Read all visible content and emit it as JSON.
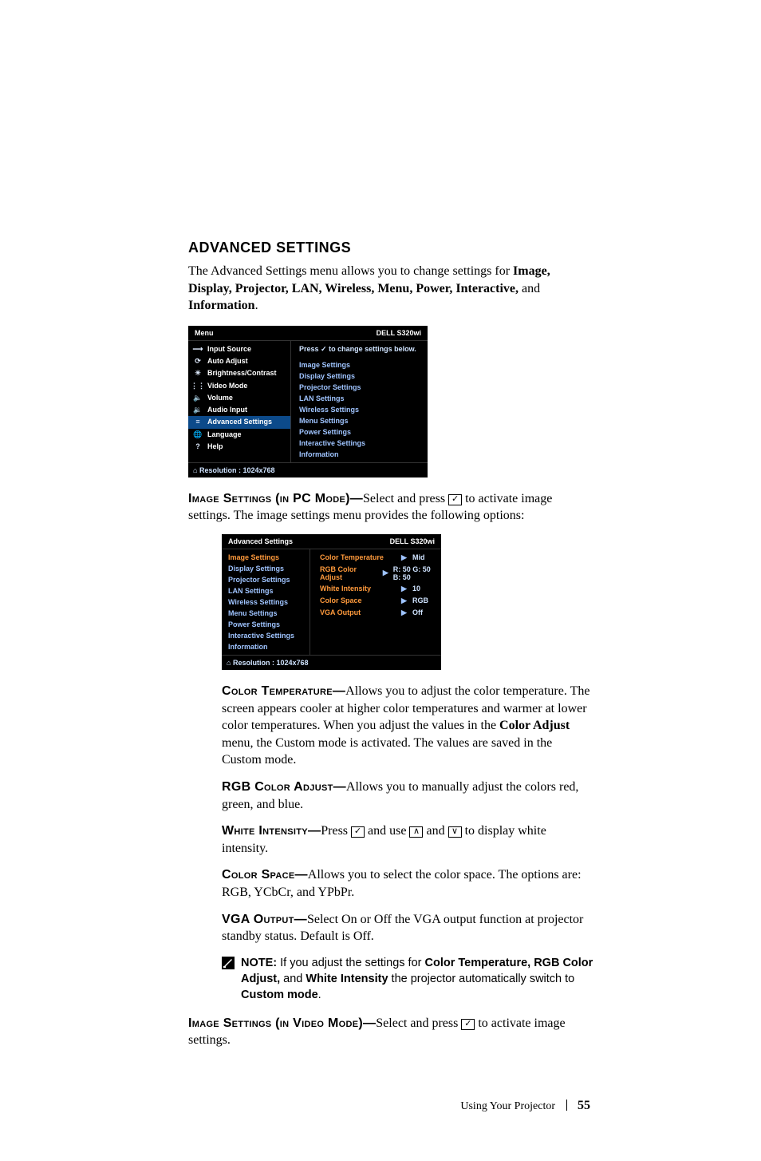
{
  "section": {
    "title": "ADVANCED SETTINGS",
    "intro_a": "The Advanced Settings menu allows you to change settings for ",
    "intro_b": "Image, Display, Projector, LAN, Wireless, Menu, Power, Interactive,",
    "intro_c": " and ",
    "intro_d": "Information",
    "intro_e": "."
  },
  "osd1": {
    "title_left": "Menu",
    "title_right": "DELL S320wi",
    "press_prefix": "Press ",
    "press_glyph": "✓",
    "press_suffix": " to change settings below.",
    "left_items": [
      {
        "icon": "⟶",
        "label": "Input Source"
      },
      {
        "icon": "⟳",
        "label": "Auto Adjust"
      },
      {
        "icon": "☀",
        "label": "Brightness/Contrast"
      },
      {
        "icon": "⋮⋮",
        "label": "Video Mode"
      },
      {
        "icon": "🔈",
        "label": "Volume"
      },
      {
        "icon": "🔉",
        "label": "Audio Input"
      },
      {
        "icon": "≡",
        "label": "Advanced Settings",
        "selected": true
      },
      {
        "icon": "🌐",
        "label": "Language"
      },
      {
        "icon": "?",
        "label": "Help"
      }
    ],
    "right_items": [
      "Image Settings",
      "Display Settings",
      "Projector Settings",
      "LAN Settings",
      "Wireless Settings",
      "Menu Settings",
      "Power Settings",
      "Interactive Settings",
      "Information"
    ],
    "footer": "Resolution : 1024x768"
  },
  "para_pc": {
    "runin": "Image Settings (in PC Mode)—",
    "a": "Select and press ",
    "b": " to activate image settings. The image settings menu provides the following options:"
  },
  "osd2": {
    "title_left": "Advanced Settings",
    "title_right": "DELL S320wi",
    "left_items": [
      {
        "label": "Image Settings",
        "selected": true
      },
      {
        "label": "Display Settings"
      },
      {
        "label": "Projector Settings"
      },
      {
        "label": "LAN Settings"
      },
      {
        "label": "Wireless Settings"
      },
      {
        "label": "Menu Settings"
      },
      {
        "label": "Power Settings"
      },
      {
        "label": "Interactive Settings"
      },
      {
        "label": "Information"
      }
    ],
    "kv": [
      {
        "k": "Color Temperature",
        "v": "Mid"
      },
      {
        "k": "RGB Color Adjust",
        "v": "R: 50 G: 50 B: 50"
      },
      {
        "k": "White Intensity",
        "v": "10"
      },
      {
        "k": "Color Space",
        "v": "RGB"
      },
      {
        "k": "VGA Output",
        "v": "Off"
      }
    ],
    "footer": "Resolution : 1024x768"
  },
  "desc": {
    "color_temp": {
      "runin": "Color Temperature—",
      "text": "Allows you to adjust the color temperature. The screen appears cooler at higher color temperatures and warmer at lower color temperatures. When you adjust the values in the ",
      "bold": "Color Adjust",
      "text2": " menu, the Custom mode is activated. The values are saved in the Custom mode."
    },
    "rgb": {
      "runin": "RGB Color Adjust—",
      "text": "Allows you to manually adjust the colors red, green, and blue."
    },
    "white": {
      "runin": "White Intensity—",
      "a": "Press ",
      "b": " and use ",
      "c": " and ",
      "d": " to display white intensity."
    },
    "cspace": {
      "runin": "Color Space—",
      "text": "Allows you to select the color space. The options are: RGB, YCbCr, and YPbPr."
    },
    "vga": {
      "runin": "VGA Output—",
      "text": "Select On or Off the VGA output function at projector standby status. Default is Off."
    }
  },
  "note": {
    "label": "NOTE:",
    "a": " If you adjust the settings for ",
    "b": "Color Temperature, RGB Color Adjust,",
    "c": " and ",
    "d": "White Intensity",
    "e": " the projector automatically switch to ",
    "f": "Custom mode",
    "g": "."
  },
  "para_video": {
    "runin": "Image Settings (in Video Mode)—",
    "a": "Select and press ",
    "b": " to activate image settings."
  },
  "footer": {
    "text": "Using Your Projector",
    "page": "55"
  },
  "glyphs": {
    "check": "✓",
    "up": "∧",
    "down": "∨",
    "tri": "▶"
  }
}
